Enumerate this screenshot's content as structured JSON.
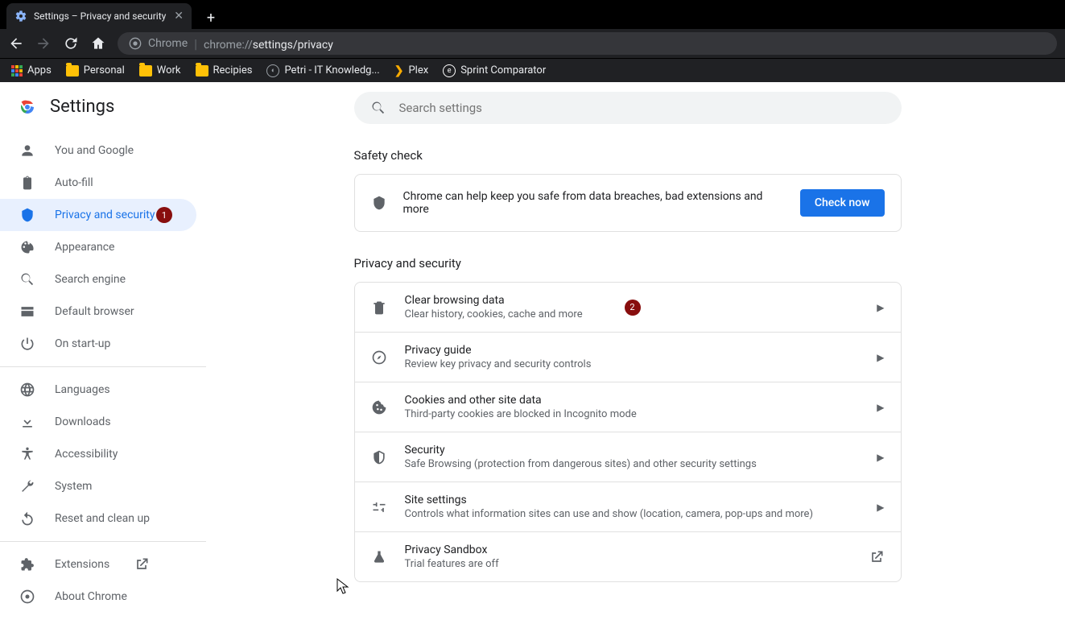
{
  "browser": {
    "tab_title": "Settings – Privacy and security",
    "address_prefix": "Chrome",
    "address_url_gray": "chrome://",
    "address_url_white": "settings/privacy",
    "bookmarks": [
      {
        "type": "apps",
        "label": "Apps"
      },
      {
        "type": "folder",
        "label": "Personal"
      },
      {
        "type": "folder",
        "label": "Work"
      },
      {
        "type": "folder",
        "label": "Recipies"
      },
      {
        "type": "site",
        "label": "Petri - IT Knowledg..."
      },
      {
        "type": "arrow",
        "label": "Plex"
      },
      {
        "type": "sitec",
        "label": "Sprint Comparator"
      }
    ]
  },
  "sidebar": {
    "title": "Settings",
    "groups": [
      [
        {
          "icon": "person",
          "label": "You and Google"
        },
        {
          "icon": "clipboard",
          "label": "Auto-fill"
        },
        {
          "icon": "shield",
          "label": "Privacy and security",
          "active": true,
          "badge": "1"
        },
        {
          "icon": "palette",
          "label": "Appearance"
        },
        {
          "icon": "search",
          "label": "Search engine"
        },
        {
          "icon": "browser",
          "label": "Default browser"
        },
        {
          "icon": "power",
          "label": "On start-up"
        }
      ],
      [
        {
          "icon": "globe",
          "label": "Languages"
        },
        {
          "icon": "download",
          "label": "Downloads"
        },
        {
          "icon": "accessibility",
          "label": "Accessibility"
        },
        {
          "icon": "wrench",
          "label": "System"
        },
        {
          "icon": "restore",
          "label": "Reset and clean up"
        }
      ],
      [
        {
          "icon": "puzzle",
          "label": "Extensions",
          "external": true
        },
        {
          "icon": "chromeicon",
          "label": "About Chrome"
        }
      ]
    ]
  },
  "content": {
    "search_placeholder": "Search settings",
    "safety": {
      "heading": "Safety check",
      "text": "Chrome can help keep you safe from data breaches, bad extensions and more",
      "button": "Check now"
    },
    "privacy": {
      "heading": "Privacy and security",
      "rows": [
        {
          "icon": "trash",
          "title": "Clear browsing data",
          "sub": "Clear history, cookies, cache and more",
          "badge": "2",
          "action": "chevron"
        },
        {
          "icon": "compass",
          "title": "Privacy guide",
          "sub": "Review key privacy and security controls",
          "action": "chevron"
        },
        {
          "icon": "cookie",
          "title": "Cookies and other site data",
          "sub": "Third-party cookies are blocked in Incognito mode",
          "action": "chevron"
        },
        {
          "icon": "shield2",
          "title": "Security",
          "sub": "Safe Browsing (protection from dangerous sites) and other security settings",
          "action": "chevron"
        },
        {
          "icon": "sliders",
          "title": "Site settings",
          "sub": "Controls what information sites can use and show (location, camera, pop-ups and more)",
          "action": "chevron"
        },
        {
          "icon": "flask",
          "title": "Privacy Sandbox",
          "sub": "Trial features are off",
          "action": "external"
        }
      ]
    }
  }
}
